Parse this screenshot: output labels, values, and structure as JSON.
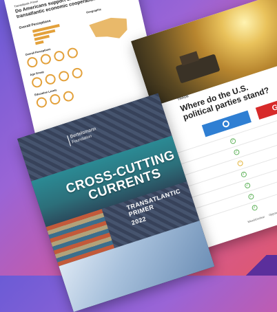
{
  "survey": {
    "kicker": "Transatlantic Primer",
    "title_line1": "Do Americans support closer",
    "title_line2": "transatlantic economic cooperation?",
    "section1": "Overall Perceptions",
    "section2": "Overall Perceptions",
    "section3": "Age Group",
    "section4": "Education Levels",
    "map_label": "Geographic"
  },
  "trade": {
    "tag": "TRADE",
    "question_line1": "Where do the U.S.",
    "question_line2": "political parties stand?",
    "gop_label": "GOP",
    "legend_dem": "Mixed/Unclear",
    "legend_gop": "Oppose"
  },
  "cover": {
    "logo_line1": "Bertelsmann",
    "logo_line2": "Foundation",
    "title_line1": "CROSS-CUTTING",
    "title_line2": "CURRENTS",
    "subtitle_line1": "TRANSATLANTIC",
    "subtitle_line2": "PRIMER",
    "year": "2022"
  },
  "colors": {
    "dem": "#2f7fd3",
    "gop": "#d72a2a",
    "accent": "#e3a13b"
  }
}
